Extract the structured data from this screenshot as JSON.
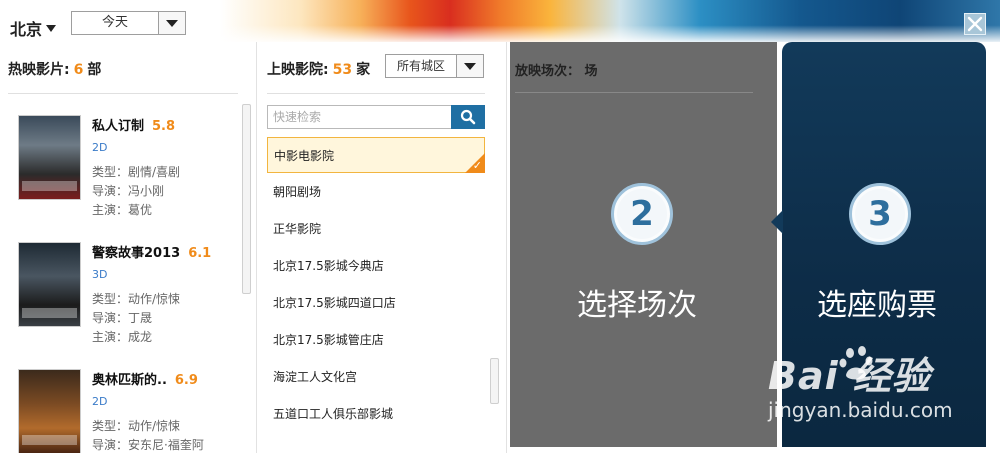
{
  "header": {
    "city": "北京",
    "date_value": "今天"
  },
  "movies": {
    "title_prefix": "热映影片:",
    "count": "6",
    "unit": "部",
    "items": [
      {
        "title": "私人订制",
        "score": "5.8",
        "format": "2D",
        "genre": "类型：剧情/喜剧",
        "director": "导演：冯小刚",
        "star": "主演：葛优"
      },
      {
        "title": "警察故事2013",
        "score": "6.1",
        "format": "3D",
        "genre": "类型：动作/惊悚",
        "director": "导演：丁晟",
        "star": "主演：成龙"
      },
      {
        "title": "奥林匹斯的..",
        "score": "6.9",
        "format": "2D",
        "genre": "类型：动作/惊悚",
        "director": "导演：安东尼·福奎阿",
        "star": ""
      }
    ]
  },
  "cinemas": {
    "title_prefix": "上映影院:",
    "count": "53",
    "unit": "家",
    "district_value": "所有城区",
    "search_placeholder": "快速检索",
    "items": [
      {
        "name": "中影电影院",
        "selected": true
      },
      {
        "name": "朝阳剧场",
        "selected": false
      },
      {
        "name": "正华影院",
        "selected": false
      },
      {
        "name": "北京17.5影城今典店",
        "selected": false
      },
      {
        "name": "北京17.5影城四道口店",
        "selected": false
      },
      {
        "name": "北京17.5影城管庄店",
        "selected": false
      },
      {
        "name": "海淀工人文化宫",
        "selected": false
      },
      {
        "name": "五道口工人俱乐部影城",
        "selected": false
      }
    ]
  },
  "sessions": {
    "title": "放映场次：  场",
    "step_number": "2",
    "step_label": "选择场次"
  },
  "seats": {
    "step_number": "3",
    "step_label": "选座购票"
  },
  "watermark": {
    "logo": "Bai  经验",
    "sub": "jingyan.baidu.com"
  },
  "colors": {
    "accent_orange": "#f08b1a",
    "search_blue": "#1f6fa3",
    "session_gray": "#6b6b6b",
    "seats_navy": "#123a5a"
  }
}
